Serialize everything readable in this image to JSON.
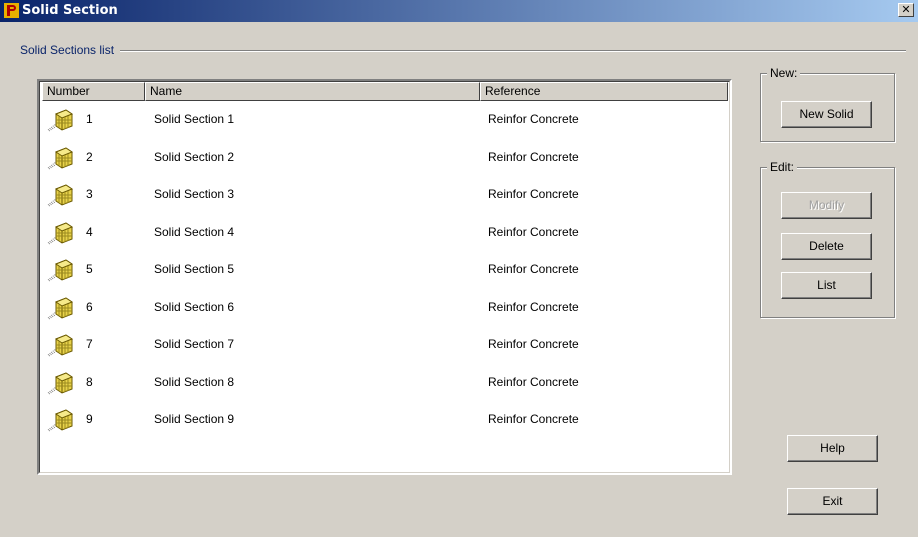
{
  "window": {
    "title": "Solid Section"
  },
  "list_section": {
    "label": "Solid Sections list"
  },
  "table": {
    "columns": [
      "Number",
      "Name",
      "Reference"
    ],
    "rows": [
      {
        "number": "1",
        "name": "Solid Section 1",
        "reference": "Reinfor Concrete"
      },
      {
        "number": "2",
        "name": "Solid Section 2",
        "reference": "Reinfor Concrete"
      },
      {
        "number": "3",
        "name": "Solid Section 3",
        "reference": "Reinfor Concrete"
      },
      {
        "number": "4",
        "name": "Solid Section 4",
        "reference": "Reinfor Concrete"
      },
      {
        "number": "5",
        "name": "Solid Section 5",
        "reference": "Reinfor Concrete"
      },
      {
        "number": "6",
        "name": "Solid Section 6",
        "reference": "Reinfor Concrete"
      },
      {
        "number": "7",
        "name": "Solid Section 7",
        "reference": "Reinfor Concrete"
      },
      {
        "number": "8",
        "name": "Solid Section 8",
        "reference": "Reinfor Concrete"
      },
      {
        "number": "9",
        "name": "Solid Section 9",
        "reference": "Reinfor Concrete"
      }
    ]
  },
  "new_group": {
    "label": "New:",
    "new_solid": "New Solid"
  },
  "edit_group": {
    "label": "Edit:",
    "modify": "Modify",
    "delete": "Delete",
    "list": "List"
  },
  "buttons": {
    "help": "Help",
    "exit": "Exit",
    "close": "✕"
  },
  "icons": {
    "app": "app-logo-icon",
    "row": "solid-section-icon",
    "close": "close-icon"
  },
  "colors": {
    "title_start": "#0a246a",
    "title_end": "#a6caf0",
    "section_label": "#0a246a",
    "disabled": "#a0a0a0"
  }
}
